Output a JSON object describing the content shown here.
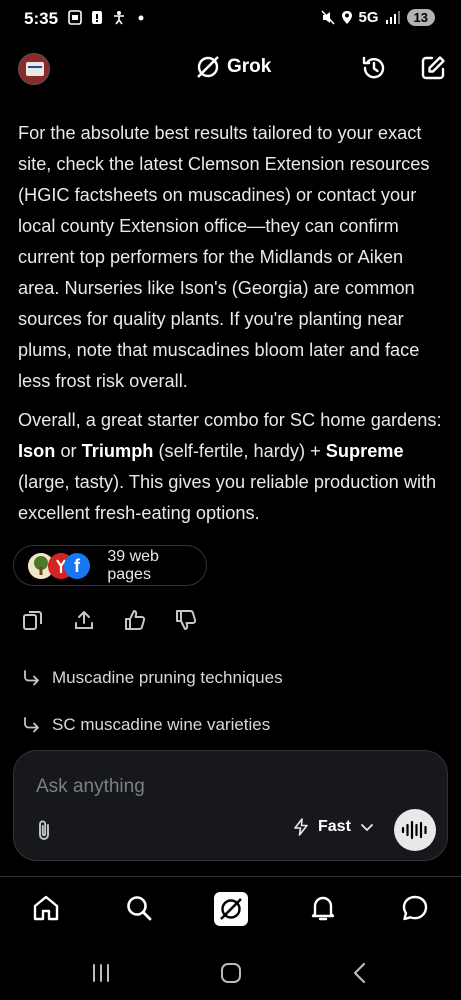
{
  "status_bar": {
    "time": "5:35",
    "network": "5G",
    "battery": "13"
  },
  "header": {
    "title": "Grok"
  },
  "message": {
    "paragraph1": "For the absolute best results tailored to your exact site, check the latest Clemson Extension resources (HGIC factsheets on muscadines) or contact your local county Extension office—they can confirm current top performers for the Midlands or Aiken area. Nurseries like Ison's (Georgia) are common sources for quality plants. If you're planting near plums, note that muscadines bloom later and face less frost risk overall.",
    "p2_intro": "Overall, a great starter combo for SC home gardens: ",
    "p2_ison": "Ison",
    "p2_or": " or ",
    "p2_triumph": "Triumph",
    "p2_mid": " (self-fertile, hardy) + ",
    "p2_supreme": "Supreme",
    "p2_end": " (large, tasty). This gives you reliable production with excellent fresh-eating options."
  },
  "sources": {
    "label": "39 web pages",
    "f_glyph": "f"
  },
  "suggestions": [
    {
      "label": "Muscadine pruning techniques"
    },
    {
      "label": "SC muscadine wine varieties"
    }
  ],
  "composer": {
    "placeholder": "Ask anything",
    "mode": "Fast"
  },
  "colors": {
    "background": "#000000",
    "text": "#e7e9ea",
    "input_bg": "#16181c",
    "border": "#2f3336"
  }
}
